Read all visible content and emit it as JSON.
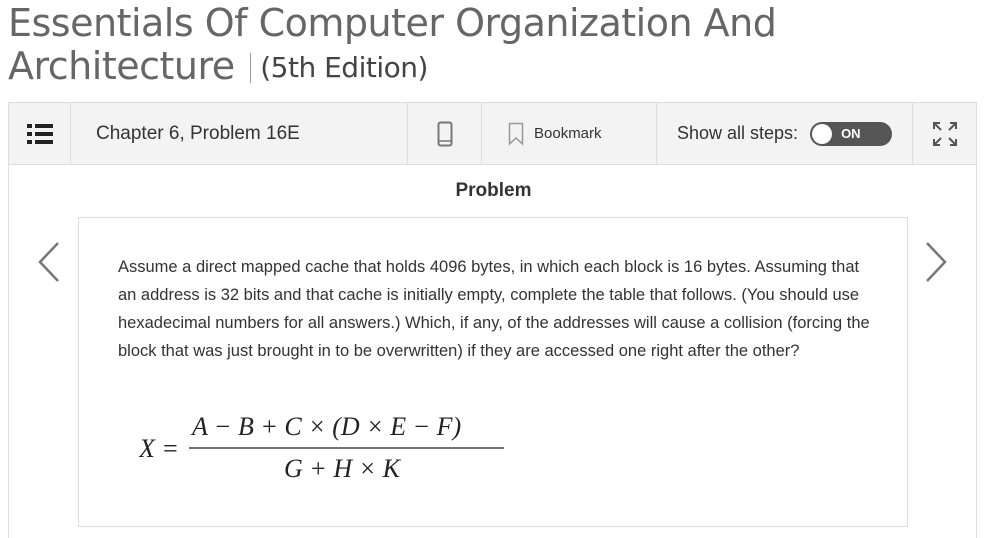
{
  "book": {
    "title": "Essentials Of Computer Organization And Architecture",
    "title_line1": "Essentials Of Computer Organization And",
    "title_line2": "Architecture",
    "edition": "(5th Edition)"
  },
  "toolbar": {
    "toc_icon": "list-icon",
    "chapter_label": "Chapter 6, Problem 16E",
    "mobile_icon": "mobile-phone-icon",
    "bookmark_label": "Bookmark",
    "show_steps_label": "Show all steps:",
    "toggle_state": "ON",
    "expand_icon": "expand-icon"
  },
  "problem": {
    "heading": "Problem",
    "text": "Assume a direct mapped cache that holds 4096 bytes, in which each block is 16 bytes. Assuming that an address is 32 bits and that cache is initially empty, complete the table that follows. (You should use hexadecimal numbers for all answers.) Which, if any, of the addresses will cause a collision (forcing the block that was just brought in to be overwritten) if they are accessed one right after the other?",
    "formula": {
      "lhs": "X =",
      "numerator": "A − B + C × (D × E − F)",
      "denominator": "G + H × K"
    }
  },
  "navigation": {
    "prev_icon": "chevron-left-icon",
    "next_icon": "chevron-right-icon"
  },
  "colors": {
    "toolbar_bg": "#f3f3f3",
    "toggle_bg": "#555555",
    "title_color": "#666666"
  }
}
